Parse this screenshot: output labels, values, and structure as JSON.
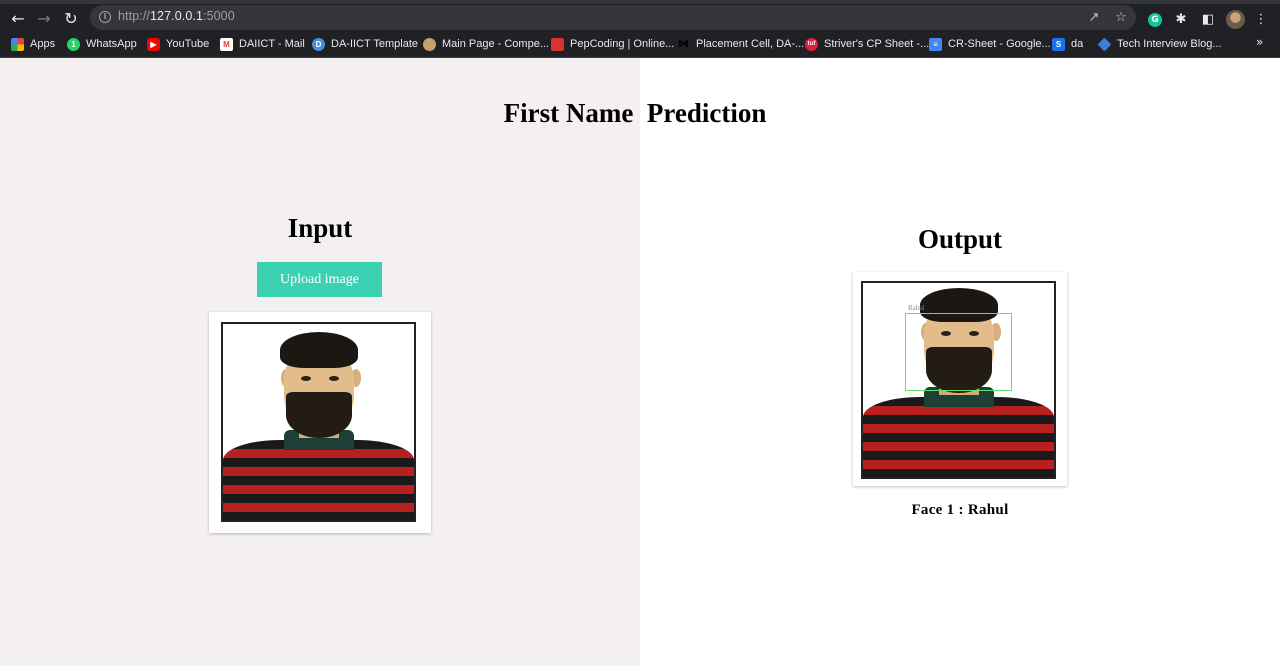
{
  "browser": {
    "url_scheme": "http://",
    "url_host": "127.0.0.1",
    "url_port": ":5000",
    "bookmarks": [
      {
        "label": "Apps",
        "icon": "apps-grid-icon",
        "color": "#4285f4"
      },
      {
        "label": "WhatsApp",
        "icon": "whatsapp-icon",
        "color": "#25d366"
      },
      {
        "label": "YouTube",
        "icon": "youtube-icon",
        "color": "#ff0000"
      },
      {
        "label": "DAIICT - Mail",
        "icon": "gmail-icon",
        "color": "#ea4335"
      },
      {
        "label": "DA-IICT Template",
        "icon": "template-icon",
        "color": "#4a90d9"
      },
      {
        "label": "Main Page - Compe...",
        "icon": "main-page-icon",
        "color": "#c7a06b"
      },
      {
        "label": "PepCoding | Online...",
        "icon": "pepcoding-icon",
        "color": "#d9342b"
      },
      {
        "label": "Placement Cell, DA-...",
        "icon": "placement-icon",
        "color": "#000000"
      },
      {
        "label": "Striver's CP Sheet -...",
        "icon": "striver-icon",
        "color": "#e0203a"
      },
      {
        "label": "CR-Sheet - Google...",
        "icon": "google-docs-icon",
        "color": "#4285f4"
      },
      {
        "label": "da",
        "icon": "s-icon",
        "color": "#1a73e8"
      },
      {
        "label": "Tech Interview Blog...",
        "icon": "tech-blog-icon",
        "color": "#3b7dd8"
      }
    ],
    "more_label": "»"
  },
  "page": {
    "title": "First Name  Prediction",
    "input": {
      "heading": "Input",
      "upload_label": "Upload image"
    },
    "output": {
      "heading": "Output",
      "detection_label": "Rahul",
      "result_text": "Face 1 : Rahul"
    }
  },
  "colors": {
    "left_bg": "#f4f0ef",
    "right_bg": "#ffffff",
    "upload_button": "#3dd1b3",
    "detection_box": "#5fe06a"
  }
}
